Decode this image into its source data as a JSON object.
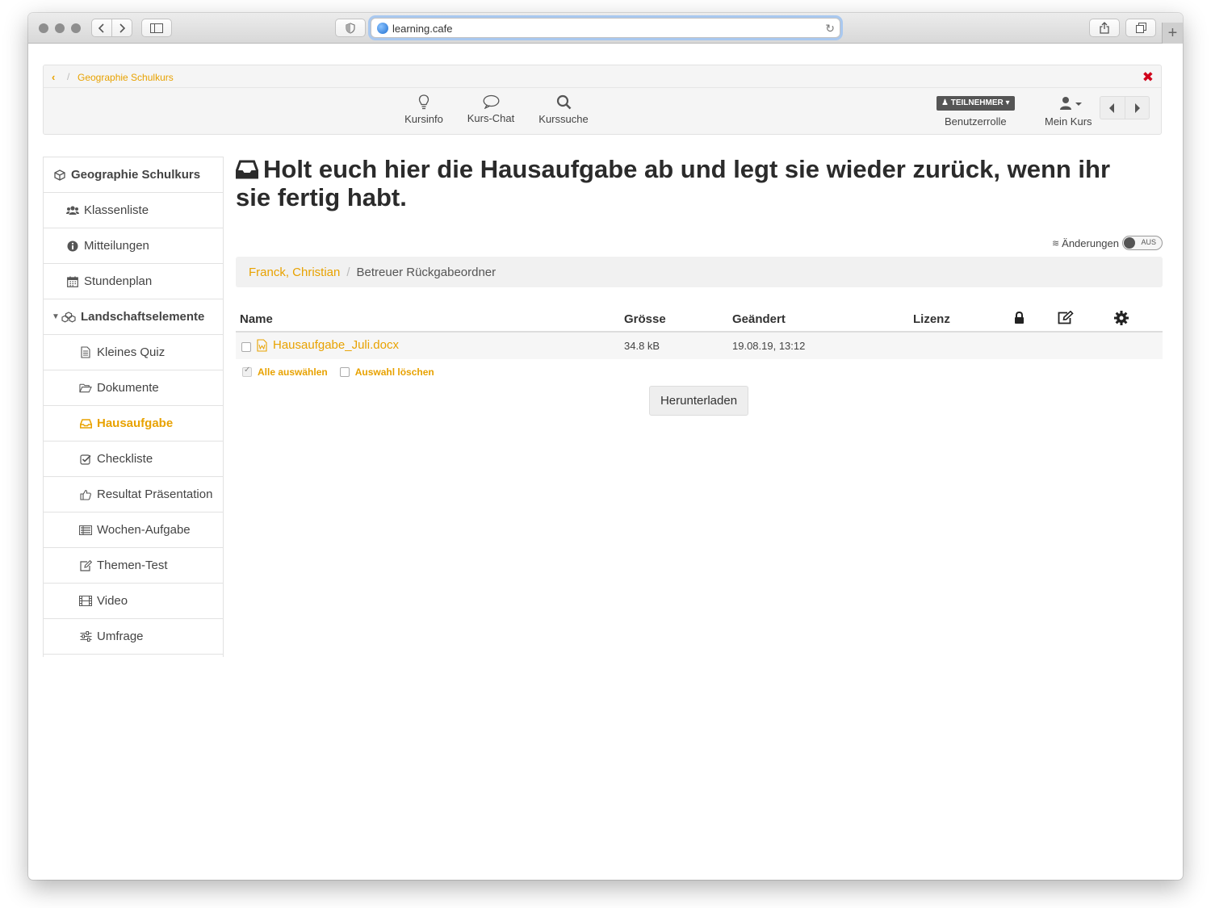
{
  "browser": {
    "url": "learning.cafe"
  },
  "course_bar": {
    "breadcrumb_title": "Geographie Schulkurs",
    "tools": [
      {
        "label": "Kursinfo",
        "icon": "lightbulb-icon"
      },
      {
        "label": "Kurs-Chat",
        "icon": "chat-bubble-icon"
      },
      {
        "label": "Kurssuche",
        "icon": "search-icon"
      }
    ],
    "role_badge": "TEILNEHMER",
    "role_label": "Benutzerrolle",
    "my_course_label": "Mein Kurs"
  },
  "sidebar": {
    "items": [
      {
        "label": "Geographie Schulkurs",
        "icon": "cube-icon"
      },
      {
        "label": "Klassenliste",
        "icon": "users-icon"
      },
      {
        "label": "Mitteilungen",
        "icon": "info-circle-icon"
      },
      {
        "label": "Stundenplan",
        "icon": "calendar-icon"
      },
      {
        "label": "Landschaftselemente",
        "icon": "cubes-icon"
      },
      {
        "label": "Kleines Quiz",
        "icon": "document-icon"
      },
      {
        "label": "Dokumente",
        "icon": "folder-open-icon"
      },
      {
        "label": "Hausaufgabe",
        "icon": "inbox-icon"
      },
      {
        "label": "Checkliste",
        "icon": "checkbox-icon"
      },
      {
        "label": "Resultat Präsentation",
        "icon": "thumbs-up-icon"
      },
      {
        "label": "Wochen-Aufgabe",
        "icon": "list-icon"
      },
      {
        "label": "Themen-Test",
        "icon": "edit-icon"
      },
      {
        "label": "Video",
        "icon": "film-icon"
      },
      {
        "label": "Umfrage",
        "icon": "sliders-icon"
      }
    ]
  },
  "main": {
    "title": "Holt euch hier die Hausaufgabe ab und legt sie wieder zurück, wenn ihr sie fertig habt.",
    "changes_label": "Änderungen",
    "changes_toggle": "AUS",
    "folder_user": "Franck, Christian",
    "folder_name": "Betreuer Rückgabeordner",
    "table": {
      "headers": {
        "name": "Name",
        "size": "Grösse",
        "modified": "Geändert",
        "license": "Lizenz"
      },
      "rows": [
        {
          "name": "Hausaufgabe_Juli.docx",
          "size": "34.8 kB",
          "modified": "19.08.19, 13:12"
        }
      ]
    },
    "select_all": "Alle auswählen",
    "clear_selection": "Auswahl löschen",
    "download_button": "Herunterladen"
  },
  "colors": {
    "accent": "#e8a200",
    "close": "#d0021b"
  }
}
